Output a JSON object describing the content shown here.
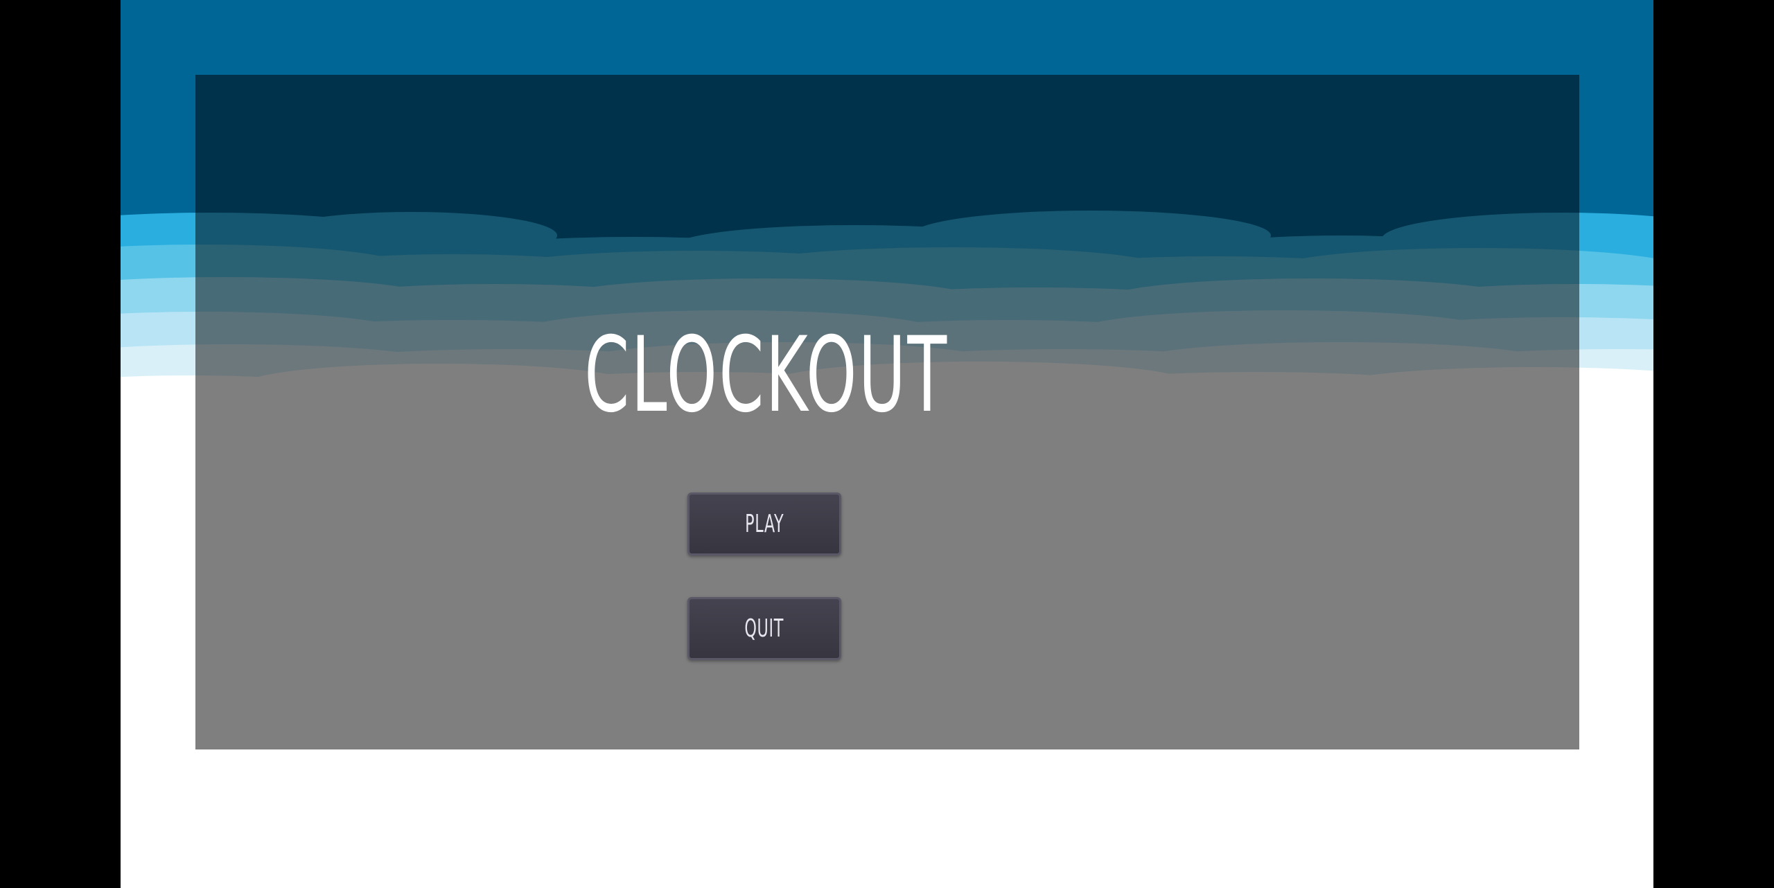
{
  "game": {
    "title": "CLOCKOUT"
  },
  "menu": {
    "play_label": "PLAY",
    "quit_label": "QUIT"
  },
  "colors": {
    "sky_top": "#006696",
    "sky_light": "#2aaee0",
    "cloud_white": "#ffffff",
    "overlay": "rgba(0,0,0,0.5)",
    "button_bg": "#3b3944",
    "button_border": "#5a5866",
    "text": "#ffffff",
    "letterbox": "#000000"
  }
}
